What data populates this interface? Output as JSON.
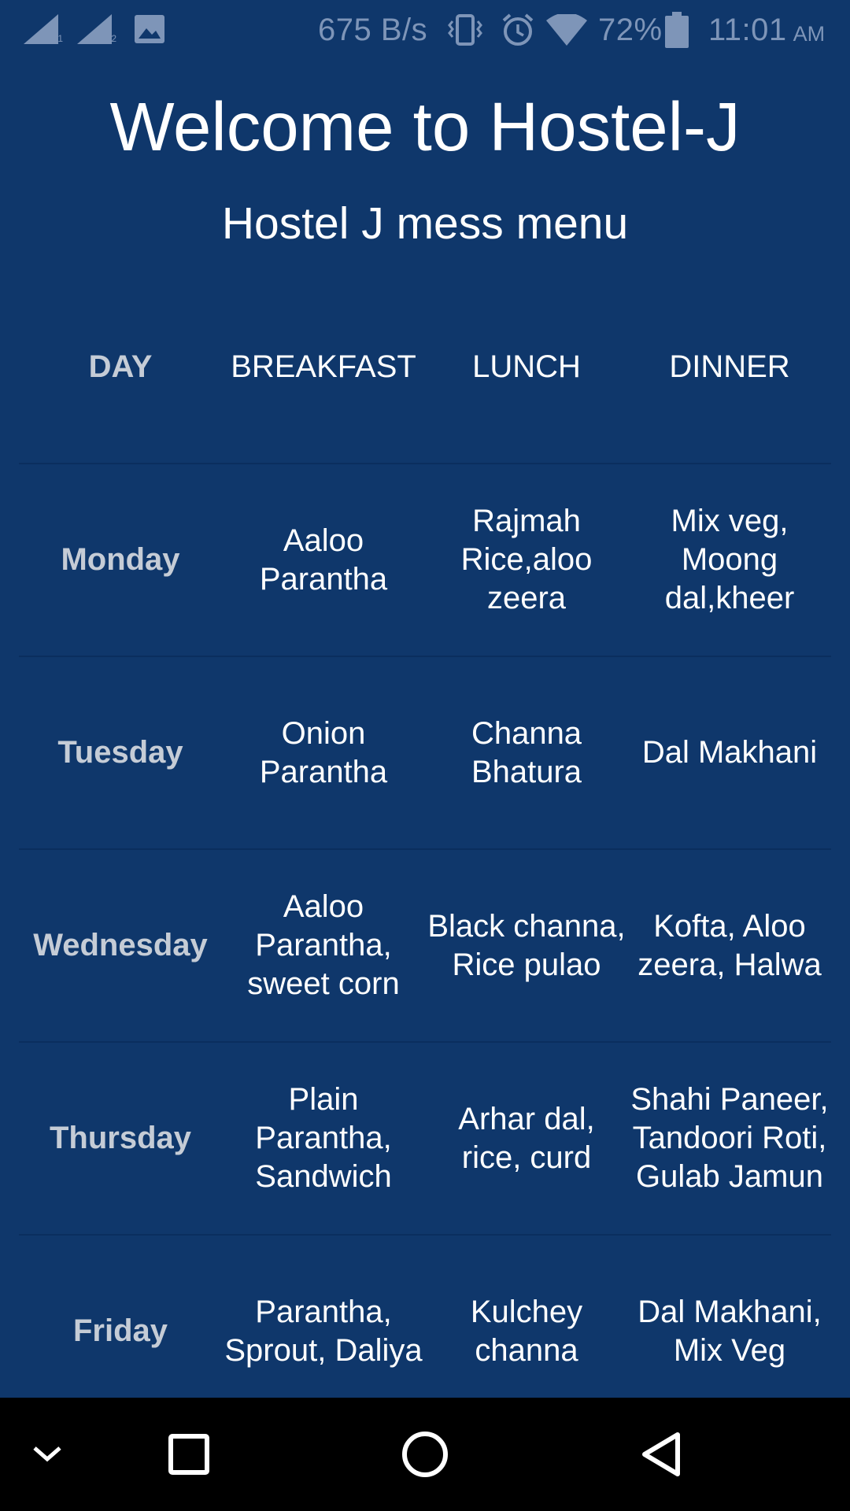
{
  "status_bar": {
    "network_speed": "675 B/s",
    "battery_percent": "72%",
    "time": "11:01",
    "ampm": "AM",
    "sim1_label": "1",
    "sim2_label": "2",
    "icons": [
      "signal-sim1-icon",
      "signal-sim2-icon",
      "image-notification-icon",
      "vibrate-icon",
      "alarm-icon",
      "wifi-icon",
      "battery-icon"
    ]
  },
  "page": {
    "title": "Welcome to Hostel-J",
    "subtitle": "Hostel J mess menu"
  },
  "menu": {
    "headers": [
      "DAY",
      "BREAKFAST",
      "LUNCH",
      "DINNER"
    ],
    "rows": [
      {
        "day": "Monday",
        "breakfast": "Aaloo Parantha",
        "lunch": "Rajmah Rice,aloo zeera",
        "dinner": "Mix veg, Moong dal,kheer"
      },
      {
        "day": "Tuesday",
        "breakfast": "Onion Parantha",
        "lunch": "Channa Bhatura",
        "dinner": "Dal Makhani"
      },
      {
        "day": "Wednesday",
        "breakfast": "Aaloo Parantha, sweet corn",
        "lunch": "Black channa, Rice pulao",
        "dinner": "Kofta, Aloo zeera, Halwa"
      },
      {
        "day": "Thursday",
        "breakfast": "Plain Parantha, Sandwich",
        "lunch": "Arhar dal, rice, curd",
        "dinner": "Shahi Paneer, Tandoori Roti, Gulab Jamun"
      },
      {
        "day": "Friday",
        "breakfast": "Parantha, Sprout, Daliya",
        "lunch": "Kulchey channa",
        "dinner": "Dal Makhani, Mix Veg"
      }
    ]
  },
  "nav_bar": {
    "icons": [
      "collapse-chevron-icon",
      "recents-square-icon",
      "home-circle-icon",
      "back-triangle-icon"
    ]
  },
  "colors": {
    "background": "#0f376b",
    "day_text": "#c5ccd6",
    "status_text": "#7e95b8",
    "nav_background": "#000000"
  }
}
